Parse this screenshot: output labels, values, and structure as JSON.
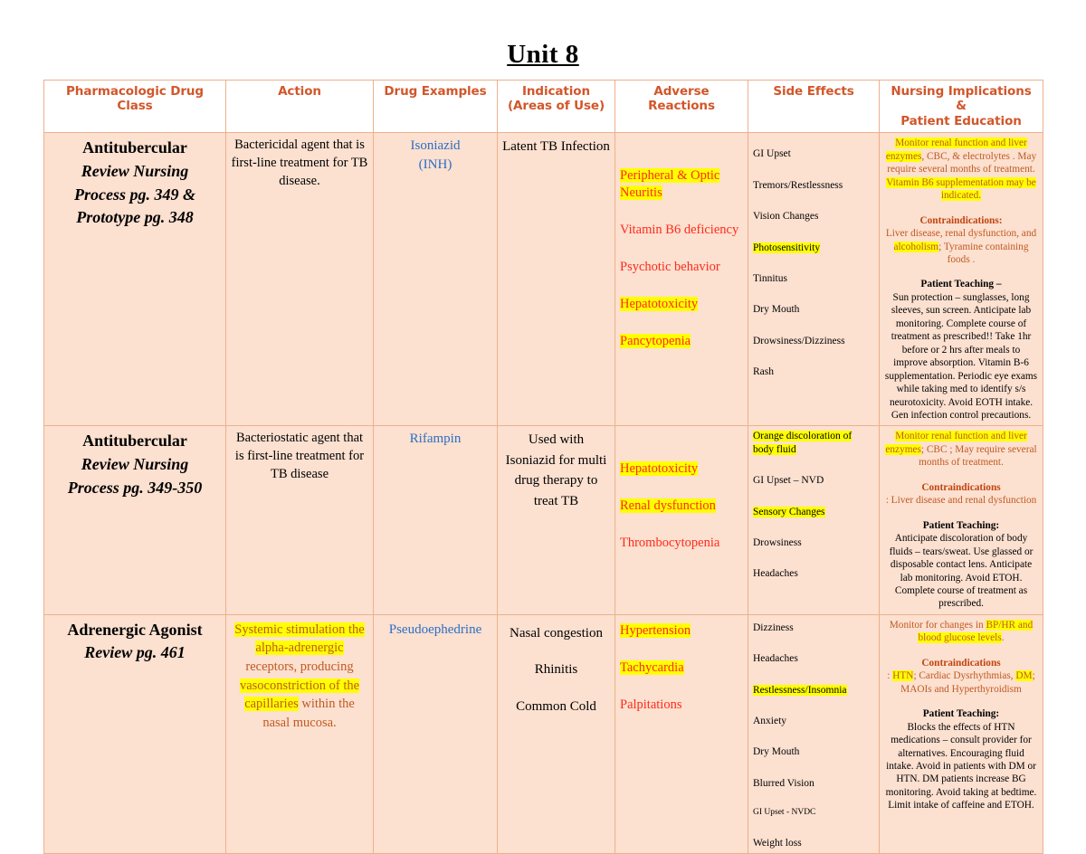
{
  "document": {
    "title": "Unit 8"
  },
  "table": {
    "headers": [
      "Pharmacologic Drug Class",
      "Action",
      "Drug Examples",
      "Indication\n(Areas of Use)",
      "Adverse Reactions",
      "Side Effects",
      "Nursing Implications &\nPatient Education"
    ],
    "header_labels": {
      "drug_class": "Pharmacologic Drug Class",
      "action": "Action",
      "drug_examples": "Drug Examples",
      "indication_line1": "Indication",
      "indication_line2": "(Areas of Use)",
      "adverse": "Adverse Reactions",
      "side_effects": "Side Effects",
      "nursing_line1": "Nursing Implications &",
      "nursing_line2": "Patient Education"
    },
    "rows": [
      {
        "drug_class": {
          "line1": "Antitubercular",
          "line2": "Review Nursing",
          "line3": "Process pg. 349 &",
          "line4": "Prototype pg. 348"
        },
        "action": "Bactericidal agent that is first-line treatment for TB disease.",
        "drug_examples": {
          "line1": "Isoniazid",
          "line2": "(INH)"
        },
        "indication": [
          "Latent TB Infection"
        ],
        "adverse": [
          {
            "text": "Peripheral & Optic Neuritis",
            "highlight": true
          },
          {
            "text": "Vitamin B6 deficiency",
            "highlight": false
          },
          {
            "text": "Psychotic behavior",
            "highlight": false
          },
          {
            "text": "Hepatotoxicity",
            "highlight": true
          },
          {
            "text": "Pancytopenia",
            "highlight": true
          }
        ],
        "side_effects": [
          {
            "text": "GI Upset",
            "highlight": false
          },
          {
            "text": "Tremors/Restlessness",
            "highlight": false
          },
          {
            "text": "Vision Changes",
            "highlight": false
          },
          {
            "text": "Photosensitivity",
            "highlight": true
          },
          {
            "text": "Tinnitus",
            "highlight": false
          },
          {
            "text": "Dry Mouth",
            "highlight": false
          },
          {
            "text": "Drowsiness/Dizziness",
            "highlight": false
          },
          {
            "text": "Rash",
            "highlight": false
          }
        ],
        "nursing": {
          "monitor_1_hl": "Monitor renal function and liver enzymes",
          "monitor_2": ", CBC, & electrolytes . May require several months of treatment. ",
          "monitor_3_hl": "Vitamin B6 supplementation may be indicated.",
          "contraindications_header": "Contraindications:",
          "contraindications_1": "Liver disease, renal dysfunction, and ",
          "contraindications_2_hl": "alcoholism",
          "contraindications_3": "; Tyramine containing foods .",
          "teaching_header": "Patient Teaching –",
          "teaching_body": "Sun protection – sunglasses, long sleeves, sun screen. Anticipate lab monitoring. Complete course of treatment as prescribed!! Take 1hr before or 2 hrs after meals to improve absorption. Vitamin B-6 supplementation. Periodic eye exams while taking med to identify s/s neurotoxicity. Avoid EOTH intake. Gen infection control precautions."
        }
      },
      {
        "drug_class": {
          "line1": "Antitubercular",
          "line2": "Review Nursing",
          "line3": "Process pg. 349-350",
          "line4": ""
        },
        "action": "Bacteriostatic agent that is first-line treatment for TB disease",
        "drug_examples": {
          "line1": "Rifampin",
          "line2": ""
        },
        "indication": [
          "Used with Isoniazid for multi drug therapy to treat TB"
        ],
        "adverse": [
          {
            "text": "Hepatotoxicity",
            "highlight": true
          },
          {
            "text": "Renal dysfunction",
            "highlight": true
          },
          {
            "text": "Thrombocytopenia",
            "highlight": false
          }
        ],
        "side_effects": [
          {
            "text": "Orange discoloration of body fluid",
            "highlight": true
          },
          {
            "text": "GI Upset – NVD",
            "highlight": false
          },
          {
            "text": "Sensory Changes",
            "highlight": true
          },
          {
            "text": "Drowsiness",
            "highlight": false
          },
          {
            "text": "Headaches",
            "highlight": false
          }
        ],
        "nursing": {
          "monitor_1_hl": "Monitor renal function and liver enzymes",
          "monitor_2": "; CBC ; May require several months of treatment.",
          "monitor_3_hl": "",
          "contraindications_header": "Contraindications",
          "contraindications_1": ":  Liver disease and renal dysfunction",
          "contraindications_2_hl": "",
          "contraindications_3": "",
          "teaching_header": "Patient Teaching:",
          "teaching_body": "Anticipate discoloration of body fluids – tears/sweat. Use glassed or disposable contact lens. Anticipate lab monitoring. Avoid ETOH. Complete course of treatment as prescribed."
        }
      },
      {
        "drug_class": {
          "line1": "Adrenergic Agonist",
          "line2": "Review pg. 461",
          "line3": "",
          "line4": ""
        },
        "action_parts": [
          {
            "text": "Systemic stimulation the alpha-adrenergic",
            "highlight": true
          },
          {
            "text": " receptors, producing ",
            "highlight": false
          },
          {
            "text": "vasoconstriction of the capillaries",
            "highlight": true
          },
          {
            "text": " within the nasal mucosa.",
            "highlight": false
          }
        ],
        "drug_examples": {
          "line1": "Pseudoephedrine",
          "line2": ""
        },
        "indication": [
          "Nasal congestion",
          "Rhinitis",
          "Common Cold"
        ],
        "adverse": [
          {
            "text": "Hypertension",
            "highlight": true
          },
          {
            "text": "Tachycardia",
            "highlight": true
          },
          {
            "text": "Palpitations",
            "highlight": false
          }
        ],
        "side_effects": [
          {
            "text": "Dizziness",
            "highlight": false
          },
          {
            "text": "Headaches",
            "highlight": false
          },
          {
            "text": "Restlessness/Insomnia",
            "highlight": true
          },
          {
            "text": "Anxiety",
            "highlight": false
          },
          {
            "text": "Dry Mouth",
            "highlight": false
          },
          {
            "text": "Blurred Vision",
            "highlight": false
          },
          {
            "text": "GI Upset - NVDC",
            "highlight": false,
            "small": true
          },
          {
            "text": "Weight loss",
            "highlight": false
          }
        ],
        "nursing": {
          "monitor_1": "Monitor for changes in ",
          "monitor_2_hl": "BP/HR and blood glucose levels",
          "monitor_3": ".",
          "contraindications_header": "Contraindications",
          "contraindications_1": ":  ",
          "contraindications_2_hl": "HTN",
          "contraindications_3": "; Cardiac Dysrhythmias, ",
          "contraindications_4_hl": "DM",
          "contraindications_5": "; MAOIs and Hyperthyroidism",
          "teaching_header": "Patient Teaching:",
          "teaching_body": "Blocks the effects of HTN medications – consult provider for alternatives. Encouraging fluid intake. Avoid in patients with DM or HTN. DM patients increase BG monitoring. Avoid taking at bedtime. Limit intake of caffeine and ETOH."
        }
      }
    ]
  },
  "colors": {
    "header_text": "#d2562a",
    "cell_background": "#fce0d0",
    "border": "#edb08c",
    "drug_example_text": "#2b6fc4",
    "adverse_text": "#ff2a1b",
    "highlight": "#ffff00",
    "orange_text": "#c05a21"
  }
}
